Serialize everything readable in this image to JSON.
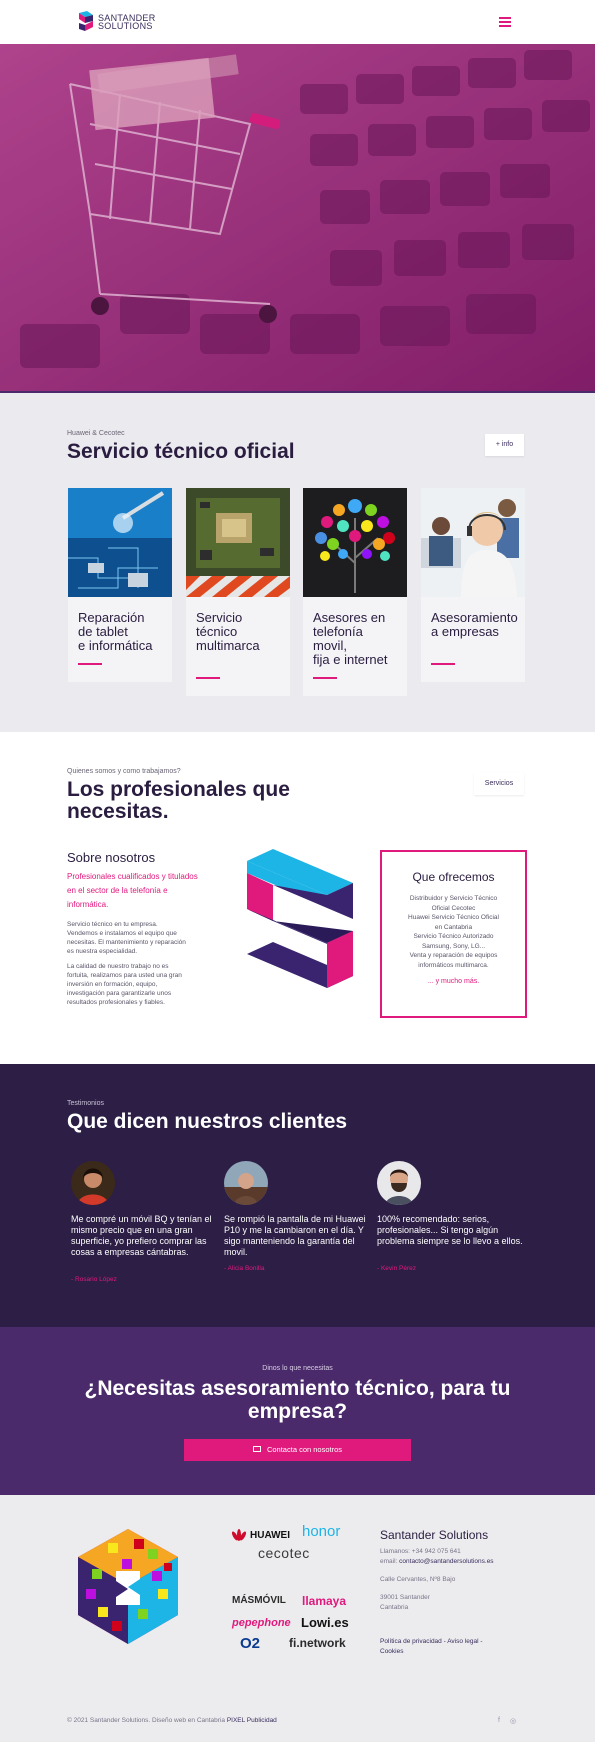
{
  "header": {
    "brand_line1": "SANTANDER",
    "brand_line2": "SOLUTIONS"
  },
  "services": {
    "eyebrow": "Huawei & Cecotec",
    "title": "Servicio técnico oficial",
    "info_button": "+ info",
    "cards": [
      {
        "label": "Reparación\nde tablet\ne informática"
      },
      {
        "label": "Servicio\ntécnico\nmultimarca"
      },
      {
        "label": "Asesores en\ntelefonía\nmovil,\nfija e internet"
      },
      {
        "label": "Asesoramiento\na empresas"
      }
    ]
  },
  "about": {
    "eyebrow": "Quienes somos y como trabajamos?",
    "title_line1": "Los profesionales que",
    "title_line2": "necesitas.",
    "services_button": "Servicios",
    "sobre_title": "Sobre nosotros",
    "accent_1": "Profesionales cualificados y titulados",
    "accent_2": "en el sector de la telefonía e",
    "accent_3": "informática.",
    "body_1": "Servicio técnico en tu empresa.",
    "body_2": "Vendemos e instalamos el equipo que",
    "body_3": "necesitas. El mantenimiento y reparación",
    "body_4": "es nuestra especialidad.",
    "body_5": "La calidad de nuestro trabajo no es",
    "body_6": "fortuita, realizamos para usted una gran",
    "body_7": "inversión en formación, equipo,",
    "body_8": "investigación para garantizarle unos",
    "body_9": "resultados profesionales y fiables.",
    "que_title": "Que ofrecemos",
    "que_lines": "Distribuidor y Servicio Técnico\nOficial Cecotec\nHuawei Servicio Técnico Oficial\nen Cantabria\nServicio Técnico Autorizado\nSamsung, Sony, LG...\nVenta y reparación de equipos\ninformáticos multimarca.",
    "que_more": "... y mucho más."
  },
  "testimonials": {
    "eyebrow": "Testimonios",
    "title": "Que dicen nuestros clientes",
    "items": [
      {
        "quote": "Me compré un móvil BQ y tenían el mismo precio que en una gran superficie, yo prefiero comprar las cosas a empresas cántabras.",
        "author": "- Rosario López"
      },
      {
        "quote": "Se rompió la pantalla de mi Huawei P10 y me la cambiaron en el día. Y sigo manteniendo la garantía del movil.",
        "author": "- Alicia Bonilla"
      },
      {
        "quote": "100% recomendado: serios, profesionales... Si tengo algún problema siempre se lo llevo a ellos.",
        "author": "- Kevin Pérez"
      }
    ]
  },
  "cta": {
    "eyebrow": "Dinos lo que necesitas",
    "title": "¿Necesitas asesoramiento técnico, para tu empresa?",
    "button": "Contacta con nosotros"
  },
  "footer": {
    "brands": {
      "huawei": "HUAWEI",
      "honor": "honor",
      "cecotec": "cecotec",
      "masmovil": "MÁSMÓVIL",
      "llamaya": "llamaya",
      "pepephone": "pepephone",
      "lowi": "Lowi.es",
      "o2": "O2",
      "finetwork": "fi.network"
    },
    "title": "Santander Solutions",
    "phone": "Llamanos: +34 942 075 641",
    "email_label": "email: ",
    "email": "contacto@santandersolutions.es",
    "street": "Calle Cervantes, Nº8 Bajo",
    "city_1": "39001 Santander",
    "city_2": "Cantabria",
    "links_1": "Política de privacidad - Aviso legal -",
    "links_2": "Cookies",
    "copyright": "© 2021 Santander Solutions. Diseño web en Cantabria ",
    "copyright_link": "PIXEL Publicidad",
    "social": [
      "f",
      "◎"
    ]
  },
  "colors": {
    "accent": "#e0197d",
    "dark": "#2c1e45",
    "purple": "#4a2a6a",
    "grey_bg": "#ebeaee"
  }
}
